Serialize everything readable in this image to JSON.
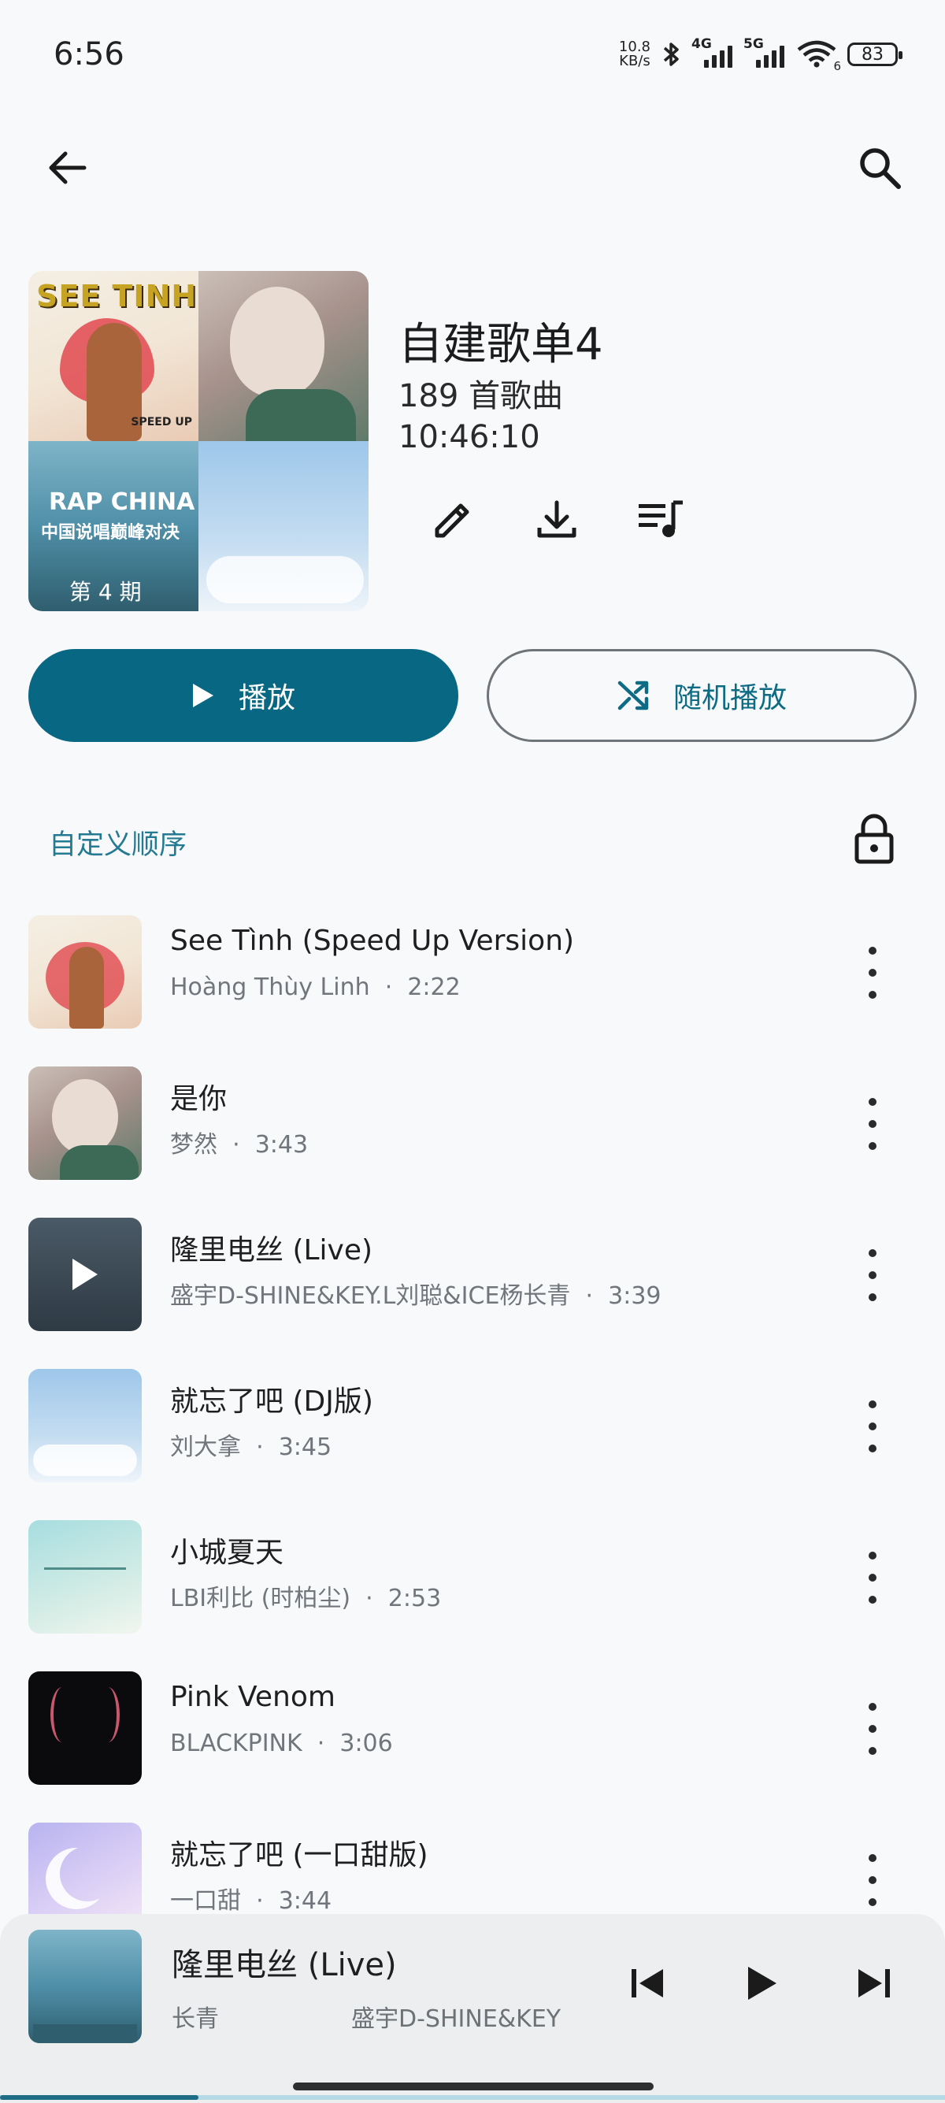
{
  "status_bar": {
    "time": "6:56",
    "net_speed_value": "10.8",
    "net_speed_unit": "KB/s",
    "signal1_label": "4G",
    "signal2_label": "5G",
    "wifi_sub": "6",
    "battery": "83"
  },
  "playlist": {
    "title": "自建歌单4",
    "count": "189 首歌曲",
    "duration": "10:46:10",
    "play_label": "播放",
    "shuffle_label": "随机播放",
    "sort_label": "自定义顺序",
    "cover_art": {
      "tile1_text": "SEE TINH",
      "tile1_badge": "SPEED UP",
      "tile3_text1": "RAP CHINA",
      "tile3_text2": "中国说唱巅峰对决",
      "tile3_text3": "第 4 期"
    }
  },
  "songs": [
    {
      "title": "See Tình (Speed Up Version)",
      "artist": "Hoàng Thùy Linh",
      "sep": "·",
      "duration": "2:22"
    },
    {
      "title": "是你",
      "artist": "梦然",
      "sep": "·",
      "duration": "3:43"
    },
    {
      "title": "隆里电丝 (Live)",
      "artist": "盛宇D-SHINE&KEY.L刘聪&ICE杨长青",
      "sep": "·",
      "duration": "3:39"
    },
    {
      "title": "就忘了吧 (DJ版)",
      "artist": "刘大拿",
      "sep": "·",
      "duration": "3:45"
    },
    {
      "title": "小城夏天",
      "artist": "LBI利比 (时柏尘)",
      "sep": "·",
      "duration": "2:53"
    },
    {
      "title": "Pink Venom",
      "artist": "BLACKPINK",
      "sep": "·",
      "duration": "3:06"
    },
    {
      "title": "就忘了吧 (一口甜版)",
      "artist": "一口甜",
      "sep": "·",
      "duration": "3:44"
    }
  ],
  "now_playing": {
    "title": "隆里电丝 (Live)",
    "sub1": "长青",
    "sub2": "盛宇D-SHINE&KEY",
    "progress": 0.21
  },
  "colors": {
    "accent": "#086783",
    "accent_text": "#247a92",
    "background": "#f8f9fb"
  },
  "icons": {
    "back": "arrow-left-icon",
    "search": "search-icon",
    "edit": "pencil-icon",
    "download": "download-icon",
    "queue": "playlist-add-icon",
    "play": "play-icon",
    "shuffle": "shuffle-icon",
    "lock": "lock-icon",
    "more": "more-vert-icon",
    "prev": "skip-previous-icon",
    "next": "skip-next-icon"
  }
}
